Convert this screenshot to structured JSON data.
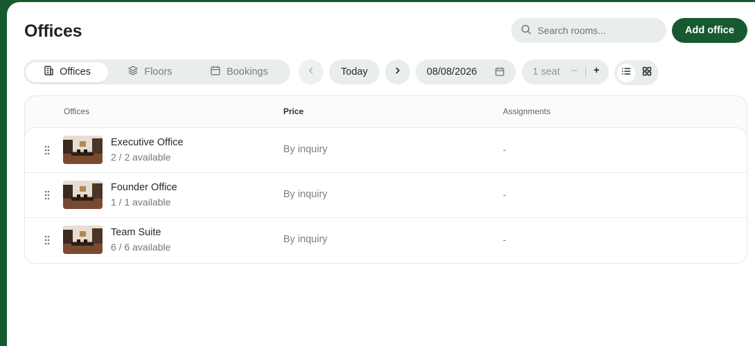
{
  "header": {
    "title": "Offices",
    "search_placeholder": "Search rooms...",
    "add_button": "Add office"
  },
  "tabs": [
    {
      "label": "Offices",
      "icon": "building-icon",
      "active": true
    },
    {
      "label": "Floors",
      "icon": "layers-icon",
      "active": false
    },
    {
      "label": "Bookings",
      "icon": "calendar-icon",
      "active": false
    }
  ],
  "toolbar": {
    "today_label": "Today",
    "date_value": "08/08/2026",
    "seat_label": "1 seat",
    "seat_minus": "–",
    "seat_plus": "+"
  },
  "table": {
    "columns": [
      "Offices",
      "Price",
      "Assignments"
    ],
    "rows": [
      {
        "name": "Executive Office",
        "availability": "2 / 2 available",
        "price": "By inquiry",
        "assignments": "-"
      },
      {
        "name": "Founder Office",
        "availability": "1 / 1 available",
        "price": "By inquiry",
        "assignments": "-"
      },
      {
        "name": "Team Suite",
        "availability": "6 / 6 available",
        "price": "By inquiry",
        "assignments": "-"
      }
    ]
  },
  "colors": {
    "brand": "#175a32",
    "pill_bg": "#e9eeeb"
  }
}
